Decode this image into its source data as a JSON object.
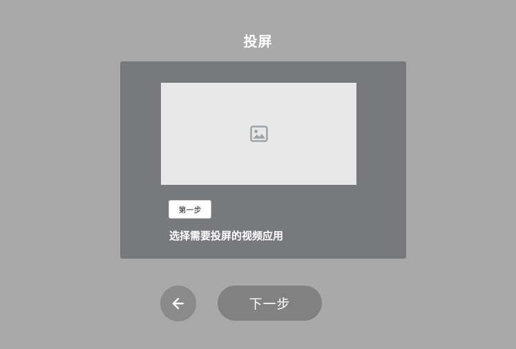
{
  "header": {
    "title": "投屏"
  },
  "card": {
    "image_icon": "image-icon",
    "step_badge": "第一步",
    "description": "选择需要投屏的视频应用"
  },
  "footer": {
    "back_icon": "arrow-left-icon",
    "next_label": "下一步"
  },
  "colors": {
    "background": "#a9a9a9",
    "card": "#78797d",
    "image_placeholder": "#e8e8e8",
    "back_button": "#8a8a8a",
    "next_button": "#818181"
  }
}
